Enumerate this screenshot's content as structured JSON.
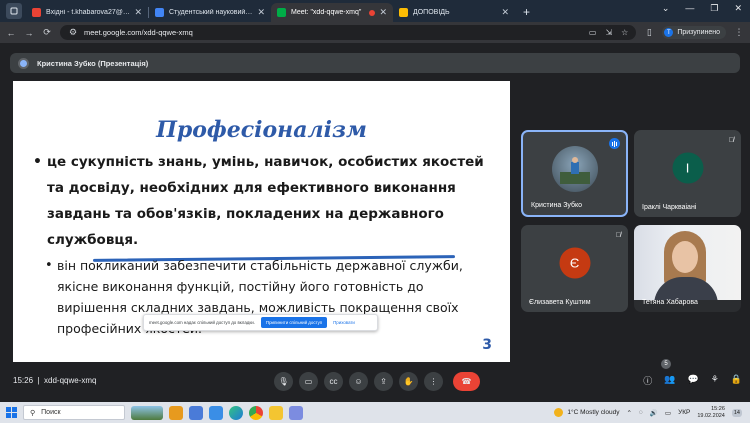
{
  "browser": {
    "tabs": [
      {
        "title": "Вхідні - t.khabarova27@gmail.c",
        "active": false,
        "favicon_color": "#ea4335"
      },
      {
        "title": "Студентський науковий гурток",
        "active": false,
        "favicon_color": "#4285f4"
      },
      {
        "title": "Meet: \"xdd-qqwe-xmq\"",
        "active": true,
        "favicon_color": "#00ac47"
      },
      {
        "title": "ДОПОВІДЬ",
        "active": false,
        "favicon_color": "#fbbc04"
      }
    ],
    "new_tab_label": "+",
    "address": "meet.google.com/xdd-qqwe-xmq",
    "profile_initial": "T",
    "profile_label": "Призупинено"
  },
  "meet": {
    "presenter_label": "Кристина Зубко (Презентація)",
    "slide": {
      "title": "Професіоналізм",
      "bullet1": "це сукупність знань, умінь, навичок, особистих якостей та досвіду, необхідних для ефективного виконання завдань та обов'язків, покладених на державного службовця.",
      "bullet2": "він покликаний забезпечити стабільність державної служби, якісне виконання функцій, постійну його готовність до вирішення складних завдань, можливість покращення своїх професійних якостей.",
      "page_number": "3"
    },
    "share_popup": {
      "text": "meet.google.com надає спільний доступ до вкладки.",
      "button": "Припинити спільний доступ",
      "hide": "Приховати"
    },
    "participants": [
      {
        "name": "Кристина Зубко",
        "speaking": true
      },
      {
        "name": "Іраклі Чаркваіані",
        "initial": "І",
        "avatar_color": "#0b5e4b",
        "muted": true
      },
      {
        "name": "Єлизавета Куштим",
        "initial": "Є",
        "avatar_color": "#c53a12",
        "muted": true
      },
      {
        "name": "Тетяна Хабарова",
        "camera": true
      }
    ],
    "time": "15:26",
    "meeting_code": "xdd-qqwe-xmq",
    "participant_count": "5"
  },
  "taskbar": {
    "search_label": "Поиск",
    "weather": "1°C Mostly cloudy",
    "language": "УКР",
    "time": "15:26",
    "date": "19.02.2024",
    "notification_count": "14"
  }
}
